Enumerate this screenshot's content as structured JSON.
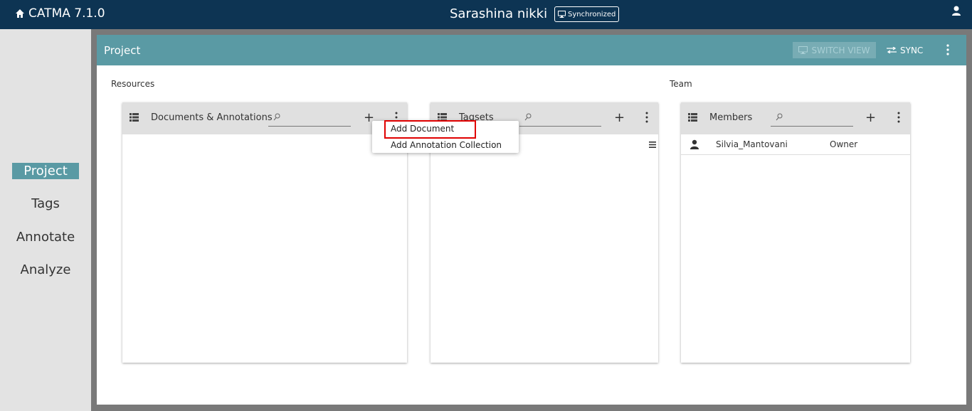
{
  "app": {
    "title": "CATMA 7.1.0",
    "project_name": "Sarashina nikki",
    "sync_status": "Synchronized"
  },
  "nav": {
    "items": [
      {
        "label": "Project",
        "active": true
      },
      {
        "label": "Tags"
      },
      {
        "label": "Annotate"
      },
      {
        "label": "Analyze"
      }
    ]
  },
  "header": {
    "title": "Project",
    "switch_view": "SWITCH VIEW",
    "sync": "SYNC"
  },
  "sections": {
    "resources": "Resources",
    "team": "Team"
  },
  "documents_card": {
    "title": "Documents & Annotations",
    "search_placeholder": ""
  },
  "tagsets_card": {
    "title": "Tagsets",
    "search_placeholder": ""
  },
  "members_card": {
    "title": "Members",
    "search_placeholder": "",
    "rows": [
      {
        "name": "Silvia_Mantovani",
        "role": "Owner"
      }
    ]
  },
  "context_menu": {
    "items": [
      "Add Document",
      "Add Annotation Collection"
    ],
    "highlighted": "Add Document"
  },
  "colors": {
    "topbar": "#0d3453",
    "accent": "#5a9aa4",
    "highlight": "#e00000"
  }
}
